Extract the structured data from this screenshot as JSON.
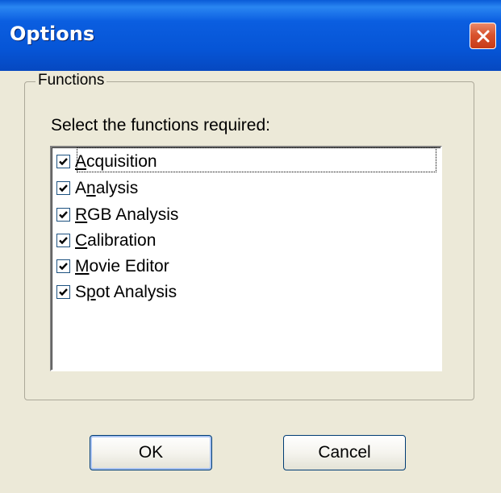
{
  "window": {
    "title": "Options"
  },
  "groupbox": {
    "legend": "Functions",
    "prompt": "Select the functions required:"
  },
  "functions": [
    {
      "before": "",
      "underline": "A",
      "after": "cquisition",
      "checked": true
    },
    {
      "before": "A",
      "underline": "n",
      "after": "alysis",
      "checked": true
    },
    {
      "before": "",
      "underline": "R",
      "after": "GB Analysis",
      "checked": true
    },
    {
      "before": "",
      "underline": "C",
      "after": "alibration",
      "checked": true
    },
    {
      "before": "",
      "underline": "M",
      "after": "ovie Editor",
      "checked": true
    },
    {
      "before": "S",
      "underline": "p",
      "after": "ot Analysis",
      "checked": true
    }
  ],
  "buttons": {
    "ok": "OK",
    "cancel": "Cancel"
  },
  "colors": {
    "titlebar": "#0655d6",
    "dialog_bg": "#ece9d8",
    "close_button": "#c83b17"
  }
}
